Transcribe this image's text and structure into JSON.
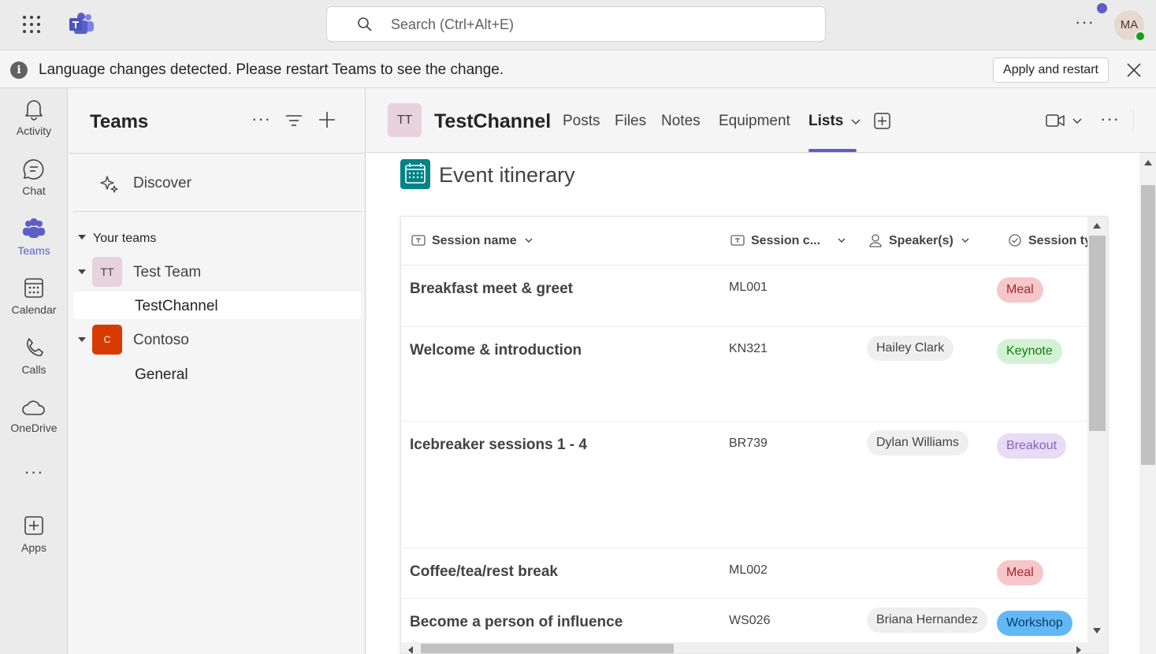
{
  "topbar": {
    "search_placeholder": "Search (Ctrl+Alt+E)",
    "avatar_initials": "MA"
  },
  "banner": {
    "message": "Language changes detected. Please restart Teams to see the change.",
    "apply_label": "Apply and restart"
  },
  "rail": {
    "items": [
      {
        "label": "Activity",
        "icon": "bell-icon"
      },
      {
        "label": "Chat",
        "icon": "chat-icon"
      },
      {
        "label": "Teams",
        "icon": "teams-icon"
      },
      {
        "label": "Calendar",
        "icon": "calendar-icon"
      },
      {
        "label": "Calls",
        "icon": "phone-icon"
      },
      {
        "label": "OneDrive",
        "icon": "cloud-icon"
      },
      {
        "label": "Apps",
        "icon": "apps-add-icon"
      }
    ]
  },
  "pane": {
    "title": "Teams",
    "discover_label": "Discover",
    "your_teams_label": "Your teams",
    "teams": [
      {
        "initials": "TT",
        "name": "Test Team",
        "channels": [
          "TestChannel"
        ]
      },
      {
        "initials": "C",
        "name": "Contoso",
        "channels": [
          "General"
        ]
      }
    ]
  },
  "channel": {
    "initials": "TT",
    "name": "TestChannel",
    "tabs": [
      "Posts",
      "Files",
      "Notes",
      "Equipment",
      "Lists"
    ],
    "active_tab": "Lists"
  },
  "list": {
    "title": "Event itinerary",
    "columns": [
      "Session name",
      "Session c...",
      "Speaker(s)",
      "Session ty"
    ],
    "rows": [
      {
        "name": "Breakfast meet & greet",
        "code": "ML001",
        "speaker": "",
        "type": "Meal"
      },
      {
        "name": "Welcome & introduction",
        "code": "KN321",
        "speaker": "Hailey Clark",
        "type": "Keynote"
      },
      {
        "name": "Icebreaker sessions 1 - 4",
        "code": "BR739",
        "speaker": "Dylan Williams",
        "type": "Breakout"
      },
      {
        "name": "Coffee/tea/rest break",
        "code": "ML002",
        "speaker": "",
        "type": "Meal"
      },
      {
        "name": "Become a person of influence",
        "code": "WS026",
        "speaker": "Briana Hernandez",
        "type": "Workshop"
      }
    ]
  },
  "colors": {
    "accent": "#5b5fc7",
    "meal_bg": "#f6c6c8",
    "meal_fg": "#a4262c",
    "keynote_bg": "#d3f2d3",
    "keynote_fg": "#107c10",
    "breakout_bg": "#e8dbf5",
    "breakout_fg": "#8764b8",
    "workshop_bg": "#62b8f6",
    "workshop_fg": "#0b3a66",
    "speaker_bg": "#efefef",
    "contoso": "#d83b01"
  }
}
